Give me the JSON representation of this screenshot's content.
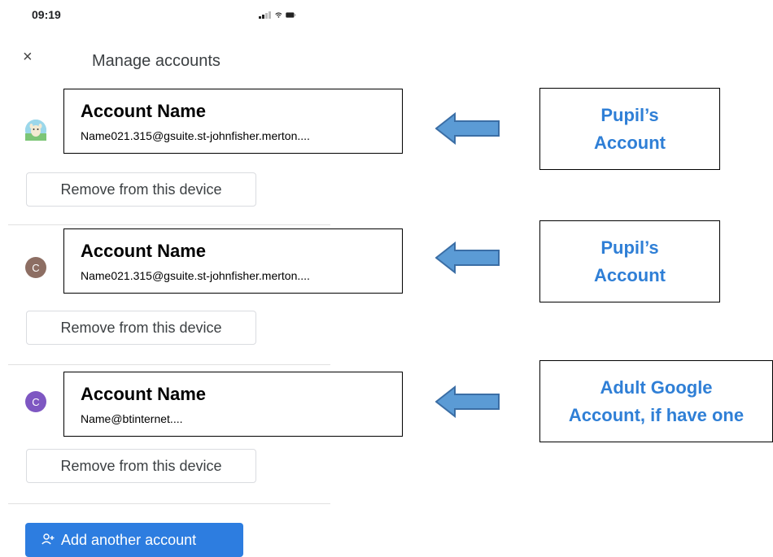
{
  "status_bar": {
    "time": "09:19"
  },
  "header": {
    "close_glyph": "×",
    "title": "Manage accounts"
  },
  "accounts": [
    {
      "name": "Account Name",
      "email": "Name021.315@gsuite.st-johnfisher.merton....",
      "avatar_letter": "",
      "avatar_color": "#8fd3e8",
      "remove_label": "Remove from this device"
    },
    {
      "name": "Account Name",
      "email": "Name021.315@gsuite.st-johnfisher.merton....",
      "avatar_letter": "C",
      "avatar_color": "#8d6e63",
      "remove_label": "Remove from this device"
    },
    {
      "name": "Account Name",
      "email": "Name@btinternet....",
      "avatar_letter": "C",
      "avatar_color": "#7e57c2",
      "remove_label": "Remove from this device"
    }
  ],
  "callouts": [
    {
      "line1": "Pupil’s",
      "line2": "Account"
    },
    {
      "line1": "Pupil’s",
      "line2": "Account"
    },
    {
      "line1": "Adult Google",
      "line2": "Account, if have one"
    }
  ],
  "add_account": {
    "label": "Add another account",
    "icon": "person-add-icon"
  },
  "colors": {
    "accent": "#2d7de0",
    "callout_text": "#2f7fd6",
    "arrow_fill": "#5b9bd5",
    "arrow_stroke": "#3b6ea5"
  }
}
